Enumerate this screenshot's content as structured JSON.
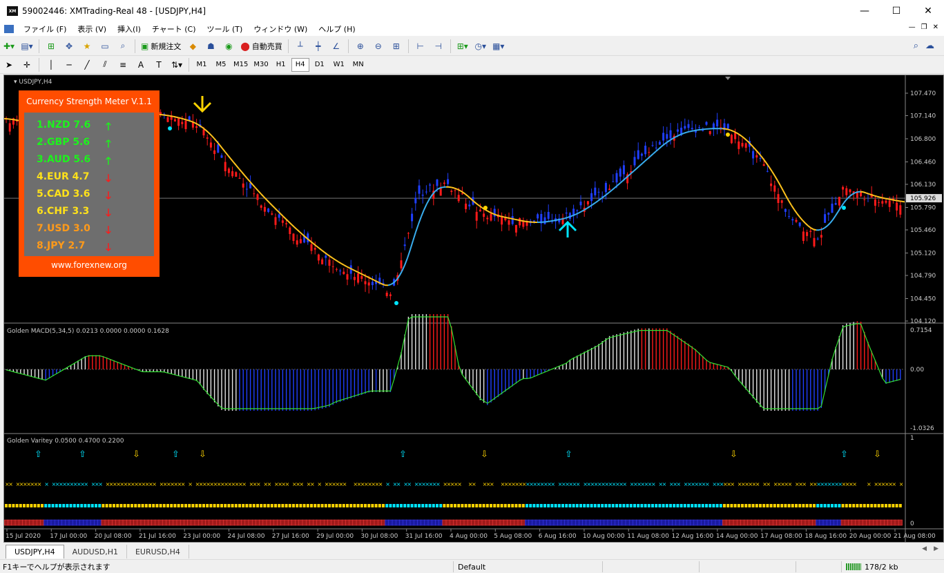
{
  "window": {
    "app_logo": "XM",
    "title": "59002446: XMTrading-Real 48 - [USDJPY,H4]",
    "minimize": "—",
    "maximize": "☐",
    "close": "✕"
  },
  "menu": {
    "items": [
      "ファイル (F)",
      "表示 (V)",
      "挿入(I)",
      "チャート (C)",
      "ツール (T)",
      "ウィンドウ (W)",
      "ヘルプ (H)"
    ],
    "mdi_minimize": "—",
    "mdi_restore": "❐",
    "mdi_close": "✕"
  },
  "toolbar": {
    "new_order": "新規注文",
    "auto_trade": "自動売買",
    "timeframes": [
      "M1",
      "M5",
      "M15",
      "M30",
      "H1",
      "H4",
      "D1",
      "W1",
      "MN"
    ],
    "active_timeframe": "H4"
  },
  "chart": {
    "symbol_label": "USDJPY,H4",
    "current_price": "105.926",
    "price_ticks": [
      "107.470",
      "107.140",
      "106.800",
      "106.460",
      "106.130",
      "105.790",
      "105.460",
      "105.120",
      "104.790",
      "104.450",
      "104.120"
    ],
    "price_range": [
      104.12,
      107.47
    ],
    "macd_label": "Golden MACD(5,34,5) 0.0213 0.0000 0.0000 0.1628",
    "macd_ticks": [
      "0.7154",
      "0.00",
      "-1.0326"
    ],
    "varitey_label": "Golden Varitey 0.0500 0.4700 0.2200",
    "varitey_ticks": [
      "1",
      "0"
    ],
    "time_labels": [
      "15 Jul 2020",
      "17 Jul 00:00",
      "20 Jul 08:00",
      "21 Jul 16:00",
      "23 Jul 00:00",
      "24 Jul 08:00",
      "27 Jul 16:00",
      "29 Jul 00:00",
      "30 Jul 08:00",
      "31 Jul 16:00",
      "4 Aug 00:00",
      "5 Aug 08:00",
      "6 Aug 16:00",
      "10 Aug 00:00",
      "11 Aug 08:00",
      "12 Aug 16:00",
      "14 Aug 00:00",
      "17 Aug 08:00",
      "18 Aug 16:00",
      "20 Aug 00:00",
      "21 Aug 08:00"
    ],
    "colors": {
      "bull": "#1f3fff",
      "bear": "#ff1a1a",
      "ma_up": "#39aef0",
      "ma_down": "#ffc21c",
      "accent_cyan": "#00e5ff",
      "accent_yellow": "#ffd400"
    }
  },
  "meter": {
    "title": "Currency Strength Meter V.1.1",
    "rows": [
      {
        "text": "1.NZD  7.6",
        "color": "#1df21d",
        "dir": "up"
      },
      {
        "text": "2.GBP  5.6",
        "color": "#1df21d",
        "dir": "up"
      },
      {
        "text": "3.AUD  5.6",
        "color": "#1df21d",
        "dir": "up"
      },
      {
        "text": "4.EUR  4.7",
        "color": "#ffe11a",
        "dir": "down"
      },
      {
        "text": "5.CAD  3.6",
        "color": "#ffe11a",
        "dir": "down"
      },
      {
        "text": "6.CHF  3.3",
        "color": "#ffe11a",
        "dir": "down"
      },
      {
        "text": "7.USD  3.0",
        "color": "#ff9a1a",
        "dir": "down"
      },
      {
        "text": "8.JPY   2.7",
        "color": "#ff9a1a",
        "dir": "down"
      }
    ],
    "up_arrow": "🡑",
    "down_arrow": "🡓",
    "site": "www.forexnew.org"
  },
  "tabs": {
    "items": [
      "USDJPY,H4",
      "AUDUSD,H1",
      "EURUSD,H4"
    ],
    "active": "USDJPY,H4"
  },
  "status": {
    "help": "F1キーでヘルプが表示されます",
    "profile": "Default",
    "traffic": "178/2 kb"
  }
}
